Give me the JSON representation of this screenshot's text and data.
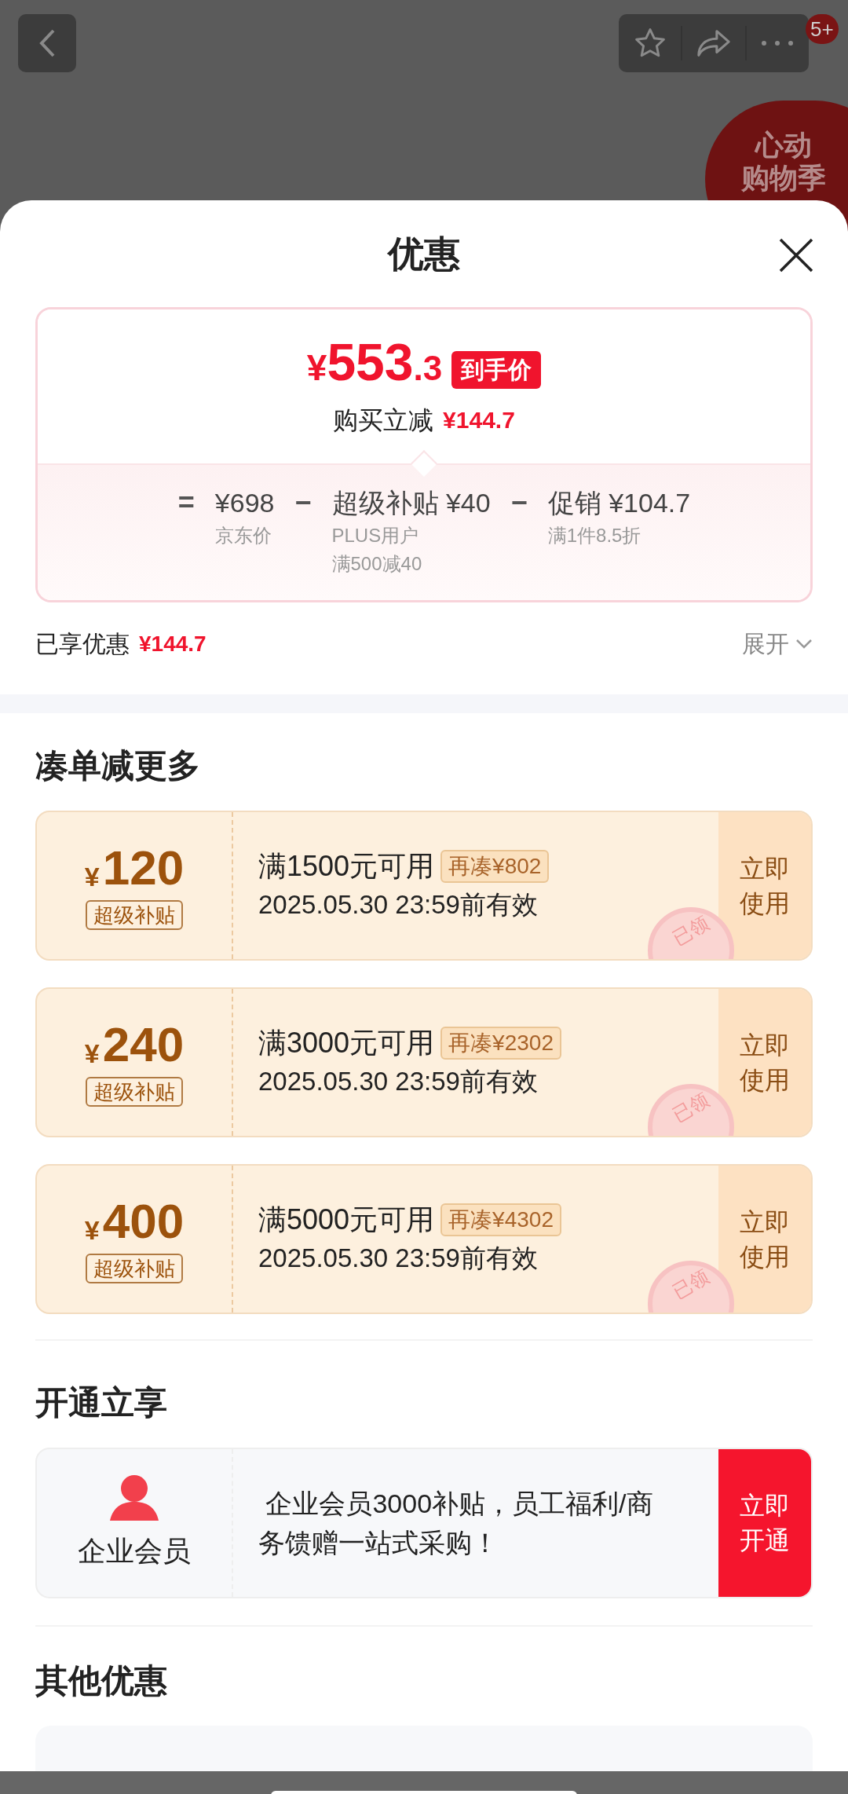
{
  "top_bar": {
    "promo_badge": [
      "心动",
      "购物季"
    ],
    "message_count": "5+"
  },
  "sheet": {
    "title": "优惠",
    "price_card": {
      "currency": "¥",
      "integer": "553",
      "decimal": ".3",
      "price_tag": "到手价",
      "saving_label": "购买立减",
      "saving_amount": "¥144.7",
      "breakdown": [
        {
          "op": "=",
          "label": "¥698",
          "notes": [
            "京东价"
          ]
        },
        {
          "op": "−",
          "label": "超级补贴 ¥40",
          "notes": [
            "PLUS用户",
            "满500减40"
          ]
        },
        {
          "op": "−",
          "label": "促销 ¥104.7",
          "notes": [
            "满1件8.5折"
          ]
        }
      ]
    },
    "enjoyed": {
      "label": "已享优惠",
      "amount": "¥144.7",
      "toggle": "展开",
      "expanded": false
    },
    "sections": [
      {
        "kind": "coupons",
        "title": "凑单减更多",
        "coupons": [
          {
            "currency": "¥",
            "amount": "120",
            "tag": "超级补贴",
            "condition": "满1500元可用",
            "gap": "再凑¥802",
            "validity": "2025.05.30 23:59前有效",
            "action": [
              "立即",
              "使用"
            ],
            "claimed": true,
            "stamp": "已领"
          },
          {
            "currency": "¥",
            "amount": "240",
            "tag": "超级补贴",
            "condition": "满3000元可用",
            "gap": "再凑¥2302",
            "validity": "2025.05.30 23:59前有效",
            "action": [
              "立即",
              "使用"
            ],
            "claimed": true,
            "stamp": "已领"
          },
          {
            "currency": "¥",
            "amount": "400",
            "tag": "超级补贴",
            "condition": "满5000元可用",
            "gap": "再凑¥4302",
            "validity": "2025.05.30 23:59前有效",
            "action": [
              "立即",
              "使用"
            ],
            "claimed": true,
            "stamp": "已领"
          }
        ]
      },
      {
        "kind": "membership",
        "title": "开通立享",
        "card": {
          "name": "企业会员",
          "description": " 企业会员3000补贴，员工福利/商务馈赠一站式采购！",
          "action": [
            "立即",
            "开通"
          ]
        }
      },
      {
        "kind": "other",
        "title": "其他优惠"
      }
    ]
  }
}
